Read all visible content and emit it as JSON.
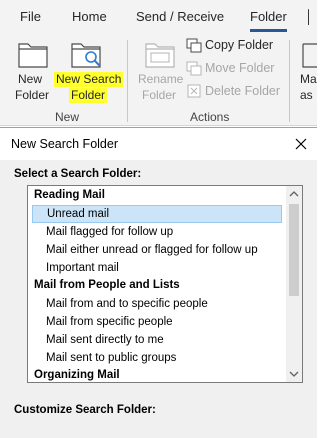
{
  "ribbon": {
    "tabs": [
      {
        "label": "File"
      },
      {
        "label": "Home"
      },
      {
        "label": "Send / Receive"
      },
      {
        "label": "Folder",
        "active": true
      }
    ],
    "groups": {
      "new": {
        "label": "New",
        "new_folder_line1": "New",
        "new_folder_line2": "Folder",
        "new_search_folder_line1": "New Search",
        "new_search_folder_line2": "Folder",
        "highlight_color": "#ffff2e"
      },
      "actions": {
        "label": "Actions",
        "rename_line1": "Rename",
        "rename_line2": "Folder",
        "copy_folder": "Copy Folder",
        "move_folder": "Move Folder",
        "delete_folder": "Delete Folder"
      },
      "cut_off": {
        "line1": "Ma",
        "line2": "as"
      }
    }
  },
  "dialog": {
    "title": "New Search Folder",
    "select_label": "Select a Search Folder:",
    "customize_label": "Customize Search Folder:",
    "list": [
      {
        "type": "header",
        "label": "Reading Mail"
      },
      {
        "type": "item",
        "label": "Unread mail",
        "selected": true
      },
      {
        "type": "item",
        "label": "Mail flagged for follow up"
      },
      {
        "type": "item",
        "label": "Mail either unread or flagged for follow up"
      },
      {
        "type": "item",
        "label": "Important mail"
      },
      {
        "type": "header",
        "label": "Mail from People and Lists"
      },
      {
        "type": "item",
        "label": "Mail from and to specific people"
      },
      {
        "type": "item",
        "label": "Mail from specific people"
      },
      {
        "type": "item",
        "label": "Mail sent directly to me"
      },
      {
        "type": "item",
        "label": "Mail sent to public groups"
      },
      {
        "type": "header",
        "label": "Organizing Mail"
      }
    ],
    "selection_color": "#cce4f7"
  }
}
